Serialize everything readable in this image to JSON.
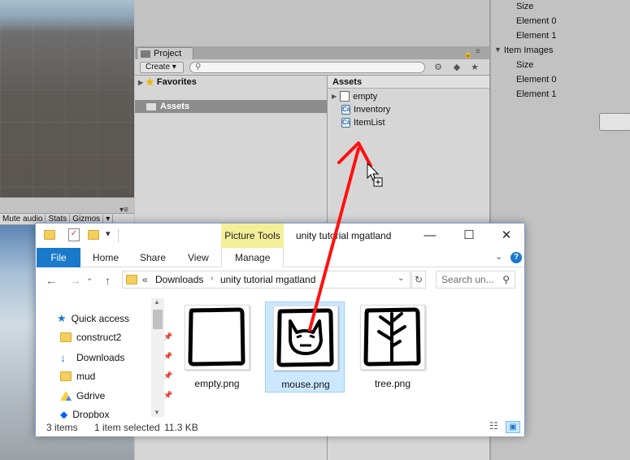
{
  "unity": {
    "game_toolbar": [
      "Mute audio",
      "Stats",
      "Gizmos"
    ],
    "project_tab": "Project",
    "create_label": "Create",
    "favorites_label": "Favorites",
    "tree_assets_label": "Assets",
    "assets_header": "Assets",
    "assets": [
      {
        "name": "empty",
        "icon": "file-icon"
      },
      {
        "name": "Inventory",
        "icon": "csharp-script-icon"
      },
      {
        "name": "ItemList",
        "icon": "csharp-script-icon"
      }
    ],
    "inspector": {
      "rows": [
        {
          "label": "Size",
          "indent": true
        },
        {
          "label": "Element 0",
          "indent": true
        },
        {
          "label": "Element 1",
          "indent": true
        },
        {
          "label": "Item Images",
          "indent": false
        },
        {
          "label": "Size",
          "indent": true
        },
        {
          "label": "Element 0",
          "indent": true
        },
        {
          "label": "Element 1",
          "indent": true
        }
      ]
    }
  },
  "explorer": {
    "context_tab": "Picture Tools",
    "title": "unity tutorial mgatland",
    "ribbon_tabs": {
      "file": "File",
      "home": "Home",
      "share": "Share",
      "view": "View",
      "manage": "Manage"
    },
    "address": {
      "prefix": "«",
      "parts": [
        "Downloads",
        "unity tutorial mgatland"
      ]
    },
    "search_placeholder": "Search un...",
    "nav": {
      "quick_access": "Quick access",
      "items": [
        "construct2",
        "Downloads",
        "mud",
        "Gdrive",
        "Dropbox"
      ]
    },
    "files": [
      {
        "name": "empty.png",
        "selected": false
      },
      {
        "name": "mouse.png",
        "selected": true
      },
      {
        "name": "tree.png",
        "selected": false
      }
    ],
    "status": {
      "count": "3 items",
      "selection": "1 item selected",
      "size": "11.3 KB"
    }
  },
  "colors": {
    "arrow": "#ff1010",
    "file_tab": "#1979ca",
    "picture_tools": "#f5ef9a",
    "selection": "#cce8ff"
  }
}
